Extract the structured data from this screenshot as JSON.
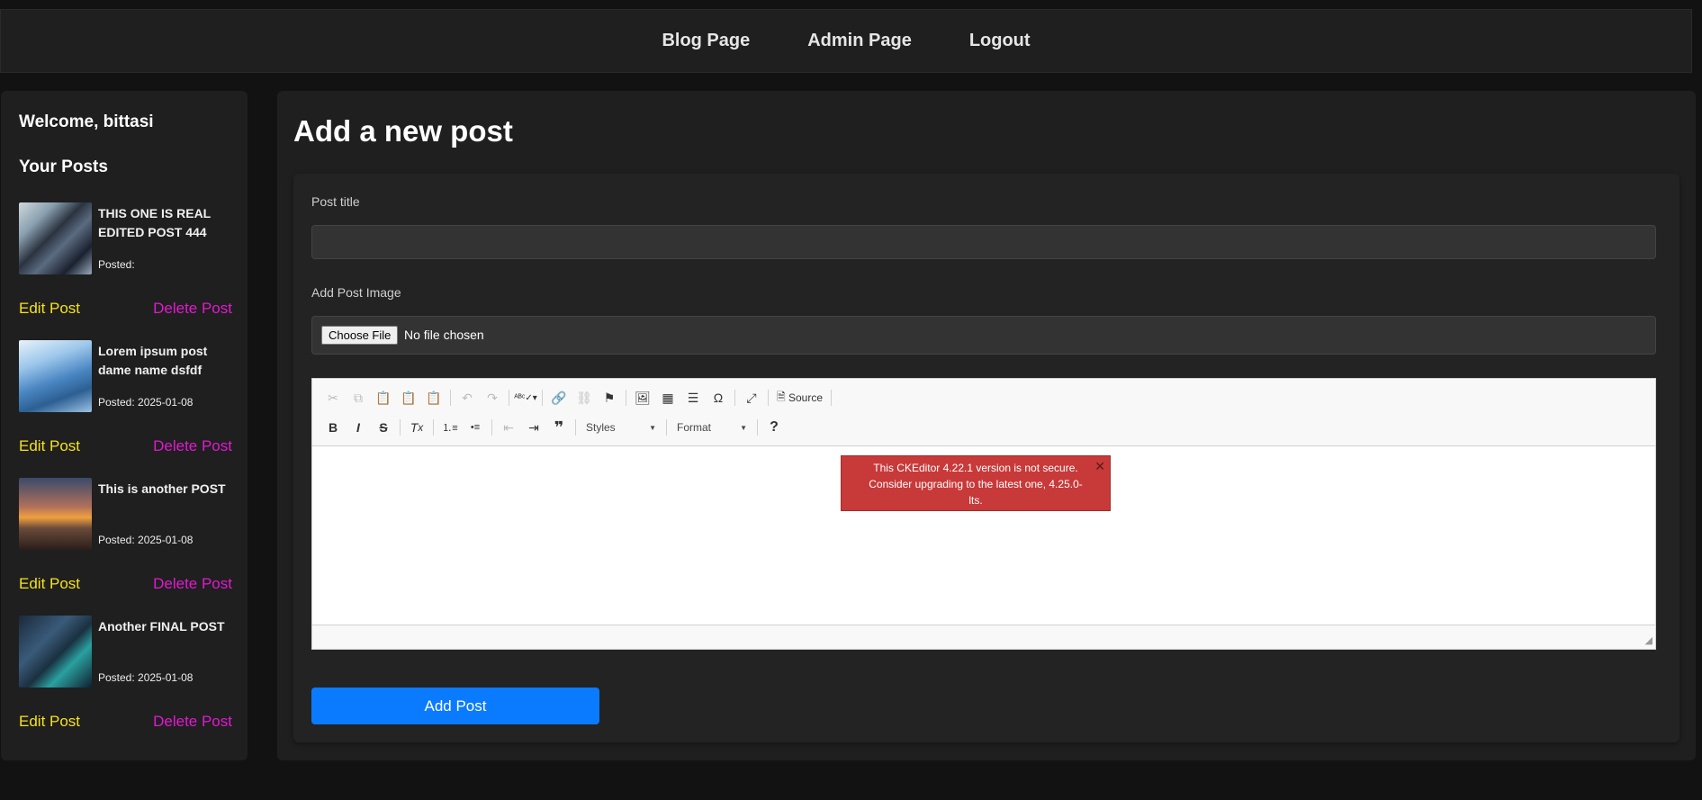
{
  "nav": {
    "items": [
      {
        "label": "Blog Page"
      },
      {
        "label": "Admin Page"
      },
      {
        "label": "Logout"
      }
    ]
  },
  "sidebar": {
    "welcome": "Welcome, bittasi",
    "heading": "Your Posts",
    "edit_label": "Edit Post",
    "delete_label": "Delete Post",
    "posts": [
      {
        "title": "THIS ONE IS REAL EDITED POST 444",
        "date": "Posted:"
      },
      {
        "title": "Lorem ipsum post dame name dsfdf",
        "date": "Posted: 2025-01-08"
      },
      {
        "title": "This is another POST",
        "date": "Posted: 2025-01-08"
      },
      {
        "title": "Another FINAL POST",
        "date": "Posted: 2025-01-08"
      }
    ]
  },
  "main": {
    "title": "Add a new post",
    "post_title_label": "Post title",
    "post_title_value": "",
    "image_label": "Add Post Image",
    "file_button": "Choose File",
    "file_status": "No file chosen",
    "editor": {
      "source_label": "Source",
      "styles_label": "Styles",
      "format_label": "Format",
      "notice": "This CKEditor 4.22.1 version is not secure. Consider upgrading to the latest one, 4.25.0-lts.",
      "notice_close": "✕"
    },
    "submit_label": "Add Post"
  },
  "colors": {
    "edit_link": "#f5e21a",
    "delete_link": "#e11ad0",
    "submit_button": "#0a7bff",
    "notice_bg": "#c83939"
  }
}
